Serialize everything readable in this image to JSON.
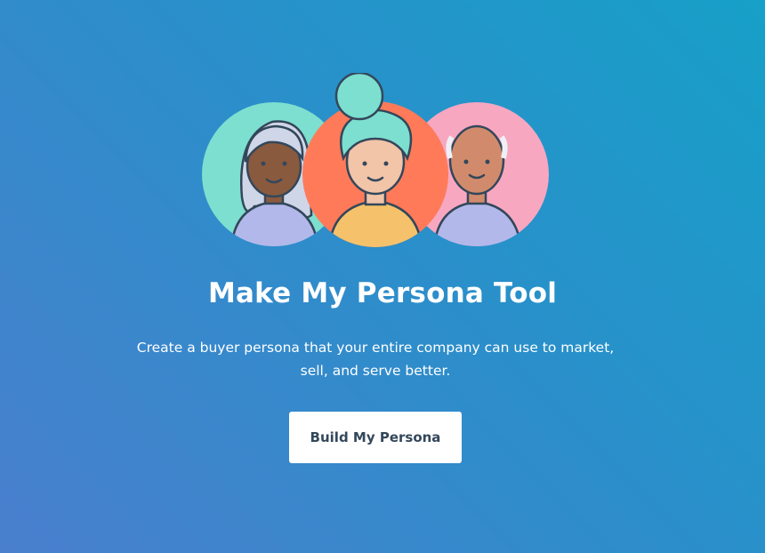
{
  "hero": {
    "title": "Make My Persona Tool",
    "subtitle": "Create a buyer persona that your entire company can use to market, sell, and serve better.",
    "cta_label": "Build My Persona"
  },
  "illustration": {
    "avatars": [
      {
        "name": "persona-left",
        "circle_color": "#7ddfcf"
      },
      {
        "name": "persona-center",
        "circle_color": "#ff7a59"
      },
      {
        "name": "persona-right",
        "circle_color": "#f8a7c0"
      }
    ]
  },
  "colors": {
    "background_start": "#17a0c8",
    "background_end": "#4a7fce",
    "button_bg": "#ffffff",
    "button_text": "#33475b"
  }
}
